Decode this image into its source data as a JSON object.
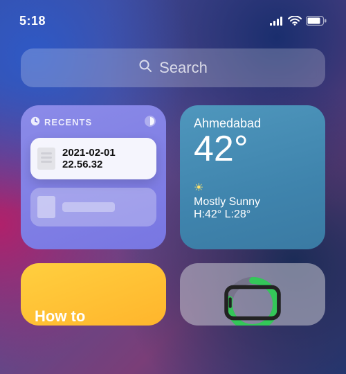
{
  "status": {
    "time": "5:18"
  },
  "search": {
    "placeholder": "Search"
  },
  "recents": {
    "header_label": "RECENTS",
    "item": {
      "line1": "2021-02-01",
      "line2": "22.56.32"
    }
  },
  "weather": {
    "city": "Ahmedabad",
    "temp": "42°",
    "condition": "Mostly Sunny",
    "range": "H:42° L:28°"
  },
  "notes": {
    "title": "How to"
  },
  "battery": {
    "percent": 78
  }
}
